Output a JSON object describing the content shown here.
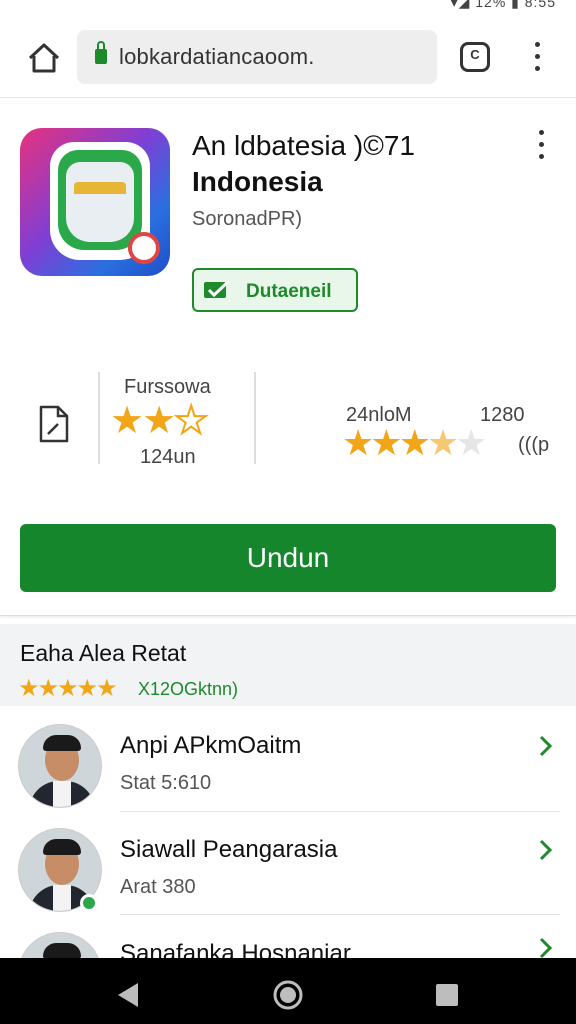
{
  "status_bar": {
    "text": "▾◢ 12% ▮ 8:55"
  },
  "browser": {
    "url": "lobkardatiancaoom.",
    "tabs_count": "C"
  },
  "app": {
    "title_line1": "An ldbatesia )©71",
    "title_line2": "Indonesia",
    "developer": "SoronadPR)",
    "badge": "Dutaeneil",
    "stats": {
      "left_label": "Furssowa",
      "left_sub": "124un",
      "left_rating": 2,
      "left_stars_total": 3,
      "right_label": "24nloM",
      "right_value": "1280",
      "right_rating": 3.5,
      "right_stars_total": 5,
      "right_side": "(((p"
    },
    "install_label": "Undun"
  },
  "reviews": {
    "title": "Eaha Alea Retat",
    "stars": 5,
    "count": "X12OGktnn)",
    "items": [
      {
        "name": "Anpi APkmOaitm",
        "sub": "Stat 5:610",
        "online": false
      },
      {
        "name": "Siawall Peangarasia",
        "sub": "Arat 380",
        "online": true
      },
      {
        "name": "Sanafanka Hosnaniar",
        "sub": "",
        "online": false
      }
    ]
  },
  "nav": {
    "back_icon": "back-triangle",
    "home_icon": "home-circle",
    "recents_icon": "recents-square"
  }
}
